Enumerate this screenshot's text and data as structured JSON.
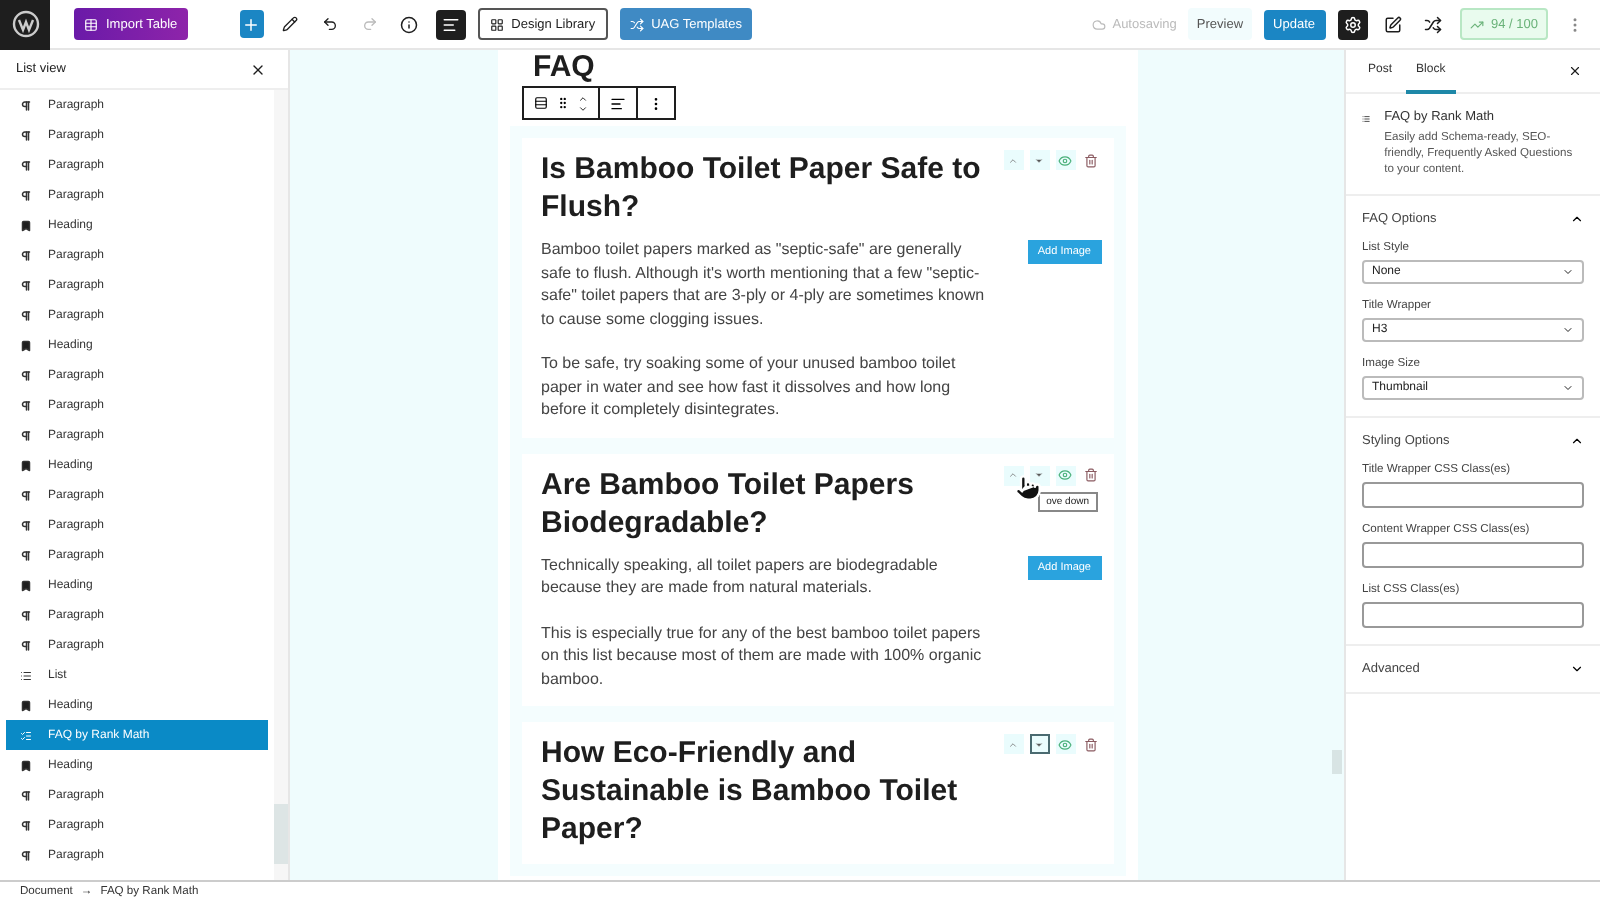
{
  "topbar": {
    "import_button": "Import Table",
    "design_library": "Design Library",
    "uag_templates": "UAG Templates",
    "autosave": "Autosaving",
    "preview": "Preview",
    "update": "Update",
    "seo_score": "94 / 100"
  },
  "list_view": {
    "title": "List view",
    "items": [
      {
        "kind": "paragraph",
        "label": "Paragraph",
        "selected": false
      },
      {
        "kind": "paragraph",
        "label": "Paragraph",
        "selected": false
      },
      {
        "kind": "paragraph",
        "label": "Paragraph",
        "selected": false
      },
      {
        "kind": "paragraph",
        "label": "Paragraph",
        "selected": false
      },
      {
        "kind": "heading",
        "label": "Heading",
        "selected": false
      },
      {
        "kind": "paragraph",
        "label": "Paragraph",
        "selected": false
      },
      {
        "kind": "paragraph",
        "label": "Paragraph",
        "selected": false
      },
      {
        "kind": "paragraph",
        "label": "Paragraph",
        "selected": false
      },
      {
        "kind": "heading",
        "label": "Heading",
        "selected": false
      },
      {
        "kind": "paragraph",
        "label": "Paragraph",
        "selected": false
      },
      {
        "kind": "paragraph",
        "label": "Paragraph",
        "selected": false
      },
      {
        "kind": "paragraph",
        "label": "Paragraph",
        "selected": false
      },
      {
        "kind": "heading",
        "label": "Heading",
        "selected": false
      },
      {
        "kind": "paragraph",
        "label": "Paragraph",
        "selected": false
      },
      {
        "kind": "paragraph",
        "label": "Paragraph",
        "selected": false
      },
      {
        "kind": "paragraph",
        "label": "Paragraph",
        "selected": false
      },
      {
        "kind": "heading",
        "label": "Heading",
        "selected": false
      },
      {
        "kind": "paragraph",
        "label": "Paragraph",
        "selected": false
      },
      {
        "kind": "paragraph",
        "label": "Paragraph",
        "selected": false
      },
      {
        "kind": "list",
        "label": "List",
        "selected": false
      },
      {
        "kind": "heading",
        "label": "Heading",
        "selected": false
      },
      {
        "kind": "faq",
        "label": "FAQ by Rank Math",
        "selected": true
      },
      {
        "kind": "heading",
        "label": "Heading",
        "selected": false
      },
      {
        "kind": "paragraph",
        "label": "Paragraph",
        "selected": false
      },
      {
        "kind": "paragraph",
        "label": "Paragraph",
        "selected": false
      },
      {
        "kind": "paragraph",
        "label": "Paragraph",
        "selected": false
      }
    ]
  },
  "breadcrumb": {
    "items": [
      "Document",
      "FAQ by Rank Math"
    ],
    "separator": "→"
  },
  "canvas": {
    "heading": "FAQ",
    "faqs": [
      {
        "title": "Is Bamboo Toilet Paper Safe to Flush?",
        "paragraphs": [
          "Bamboo toilet papers marked as \"septic-safe\" are generally safe to flush. Although it's worth mentioning that a few \"septic-safe\" toilet papers that are 3-ply or 4-ply are sometimes known to cause some clogging issues.",
          "To be safe, try soaking some of your unused bamboo toilet paper in water and see how fast it dissolves and how long before it completely disintegrates."
        ],
        "add_image": "Add Image",
        "down_focused": false
      },
      {
        "title": "Are Bamboo Toilet Papers Biodegradable?",
        "paragraphs": [
          "Technically speaking, all toilet papers are biodegradable because they are made from natural materials.",
          "This is especially true for any of the best bamboo toilet papers on this list because most of them are made with 100% organic bamboo."
        ],
        "add_image": "Add Image",
        "tooltip": "ove down",
        "down_focused": false
      },
      {
        "title": "How Eco-Friendly and Sustainable is Bamboo Toilet Paper?",
        "down_focused": true
      }
    ]
  },
  "settings": {
    "tabs": [
      {
        "label": "Post",
        "selected": false
      },
      {
        "label": "Block",
        "selected": true
      }
    ],
    "block": {
      "name": "FAQ by Rank Math",
      "description": "Easily add Schema-ready, SEO-friendly, Frequently Asked Questions to your content."
    },
    "panels": [
      {
        "title": "FAQ Options",
        "expanded": true,
        "fields": [
          {
            "kind": "select",
            "label": "List Style",
            "value": "None"
          },
          {
            "kind": "select",
            "label": "Title Wrapper",
            "value": "H3"
          },
          {
            "kind": "select",
            "label": "Image Size",
            "value": "Thumbnail"
          }
        ]
      },
      {
        "title": "Styling Options",
        "expanded": true,
        "fields": [
          {
            "kind": "text",
            "label": "Title Wrapper CSS Class(es)"
          },
          {
            "kind": "text",
            "label": "Content Wrapper CSS Class(es)"
          },
          {
            "kind": "text",
            "label": "List CSS Class(es)"
          }
        ]
      },
      {
        "title": "Advanced",
        "expanded": false
      }
    ]
  }
}
